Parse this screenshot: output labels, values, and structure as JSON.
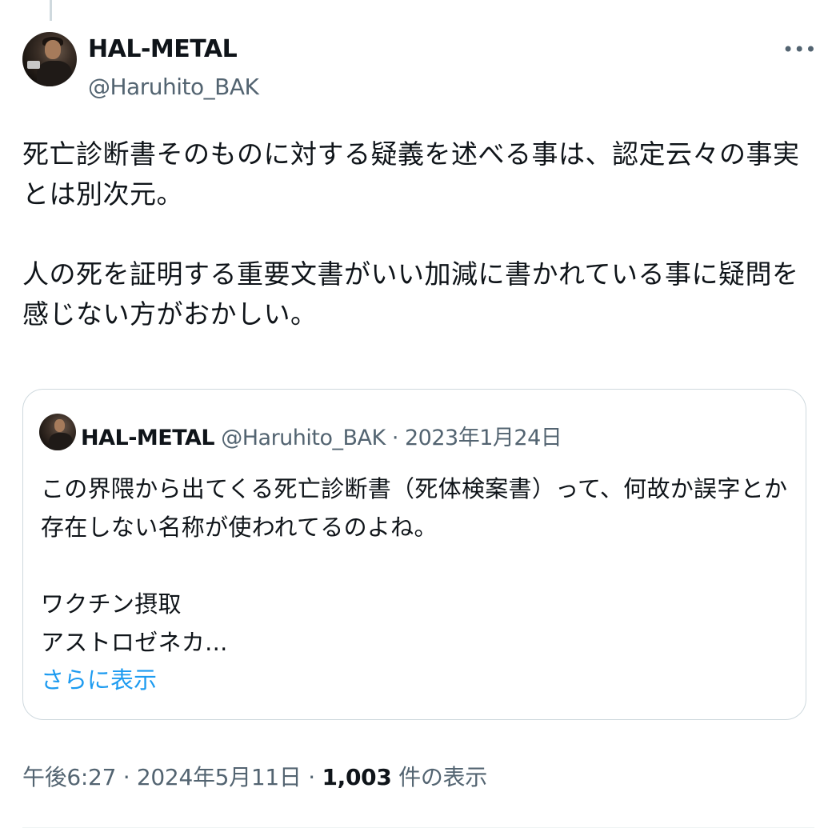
{
  "tweet": {
    "author": {
      "display_name": "HAL-METAL",
      "handle": "@Haruhito_BAK"
    },
    "more_icon": "ellipsis-icon",
    "text_paragraphs": [
      "死亡診断書そのものに対する疑義を述べる事は、認定云々の事実とは別次元。",
      "人の死を証明する重要文書がいい加減に書かれている事に疑問を感じない方がおかしい。"
    ],
    "quoted": {
      "display_name": "HAL-METAL",
      "handle": "@Haruhito_BAK",
      "separator": "·",
      "date": "2023年1月24日",
      "text_paragraphs": [
        "この界隈から出てくる死亡診断書（死体検案書）って、何故か誤字とか存在しない名称が使われてるのよね。",
        "ワクチン摂取",
        "アストロゼネカ..."
      ],
      "show_more": "さらに表示"
    },
    "meta": {
      "time": "午後6:27",
      "separator": "·",
      "date": "2024年5月11日",
      "views_count": "1,003",
      "views_label": "件の表示"
    }
  },
  "colors": {
    "text_primary": "#0f1419",
    "text_secondary": "#536471",
    "link": "#1d9bf0",
    "border": "#cfd9de"
  }
}
